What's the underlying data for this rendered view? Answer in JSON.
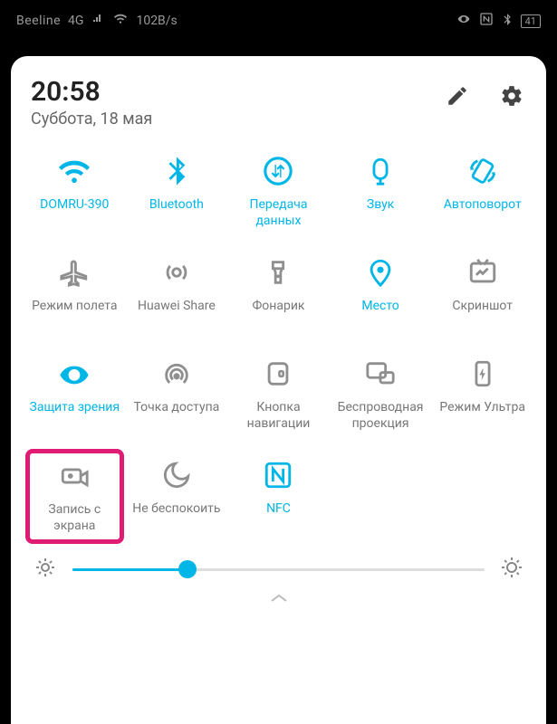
{
  "status_bar": {
    "carrier": "Beeline",
    "signal_label": "4G",
    "speed": "102B/s",
    "battery_pct": "41"
  },
  "header": {
    "time": "20:58",
    "date": "Суббота, 18 мая"
  },
  "tiles": [
    {
      "key": "wifi",
      "label": "DOMRU-390",
      "active": true
    },
    {
      "key": "bluetooth",
      "label": "Bluetooth",
      "active": true
    },
    {
      "key": "data",
      "label": "Передача данных",
      "active": true
    },
    {
      "key": "sound",
      "label": "Звук",
      "active": true
    },
    {
      "key": "rotate",
      "label": "Автоповорот",
      "active": true
    },
    {
      "key": "airplane",
      "label": "Режим полета",
      "active": false
    },
    {
      "key": "share",
      "label": "Huawei Share",
      "active": false
    },
    {
      "key": "torch",
      "label": "Фонарик",
      "active": false
    },
    {
      "key": "location",
      "label": "Место",
      "active": true
    },
    {
      "key": "screenshot",
      "label": "Скриншот",
      "active": false
    },
    {
      "key": "eyecare",
      "label": "Защита зрения",
      "active": true
    },
    {
      "key": "hotspot",
      "label": "Точка доступа",
      "active": false
    },
    {
      "key": "navbtn",
      "label": "Кнопка навигации",
      "active": false
    },
    {
      "key": "cast",
      "label": "Беспроводная проекция",
      "active": false
    },
    {
      "key": "ultra",
      "label": "Режим Ультра",
      "active": false
    },
    {
      "key": "record",
      "label": "Запись с экрана",
      "active": false,
      "highlight": true
    },
    {
      "key": "dnd",
      "label": "Не беспокоить",
      "active": false
    },
    {
      "key": "nfc",
      "label": "NFC",
      "active": true
    }
  ],
  "brightness": {
    "value_pct": 28
  },
  "colors": {
    "accent": "#00b6e6",
    "highlight": "#e01b73"
  }
}
